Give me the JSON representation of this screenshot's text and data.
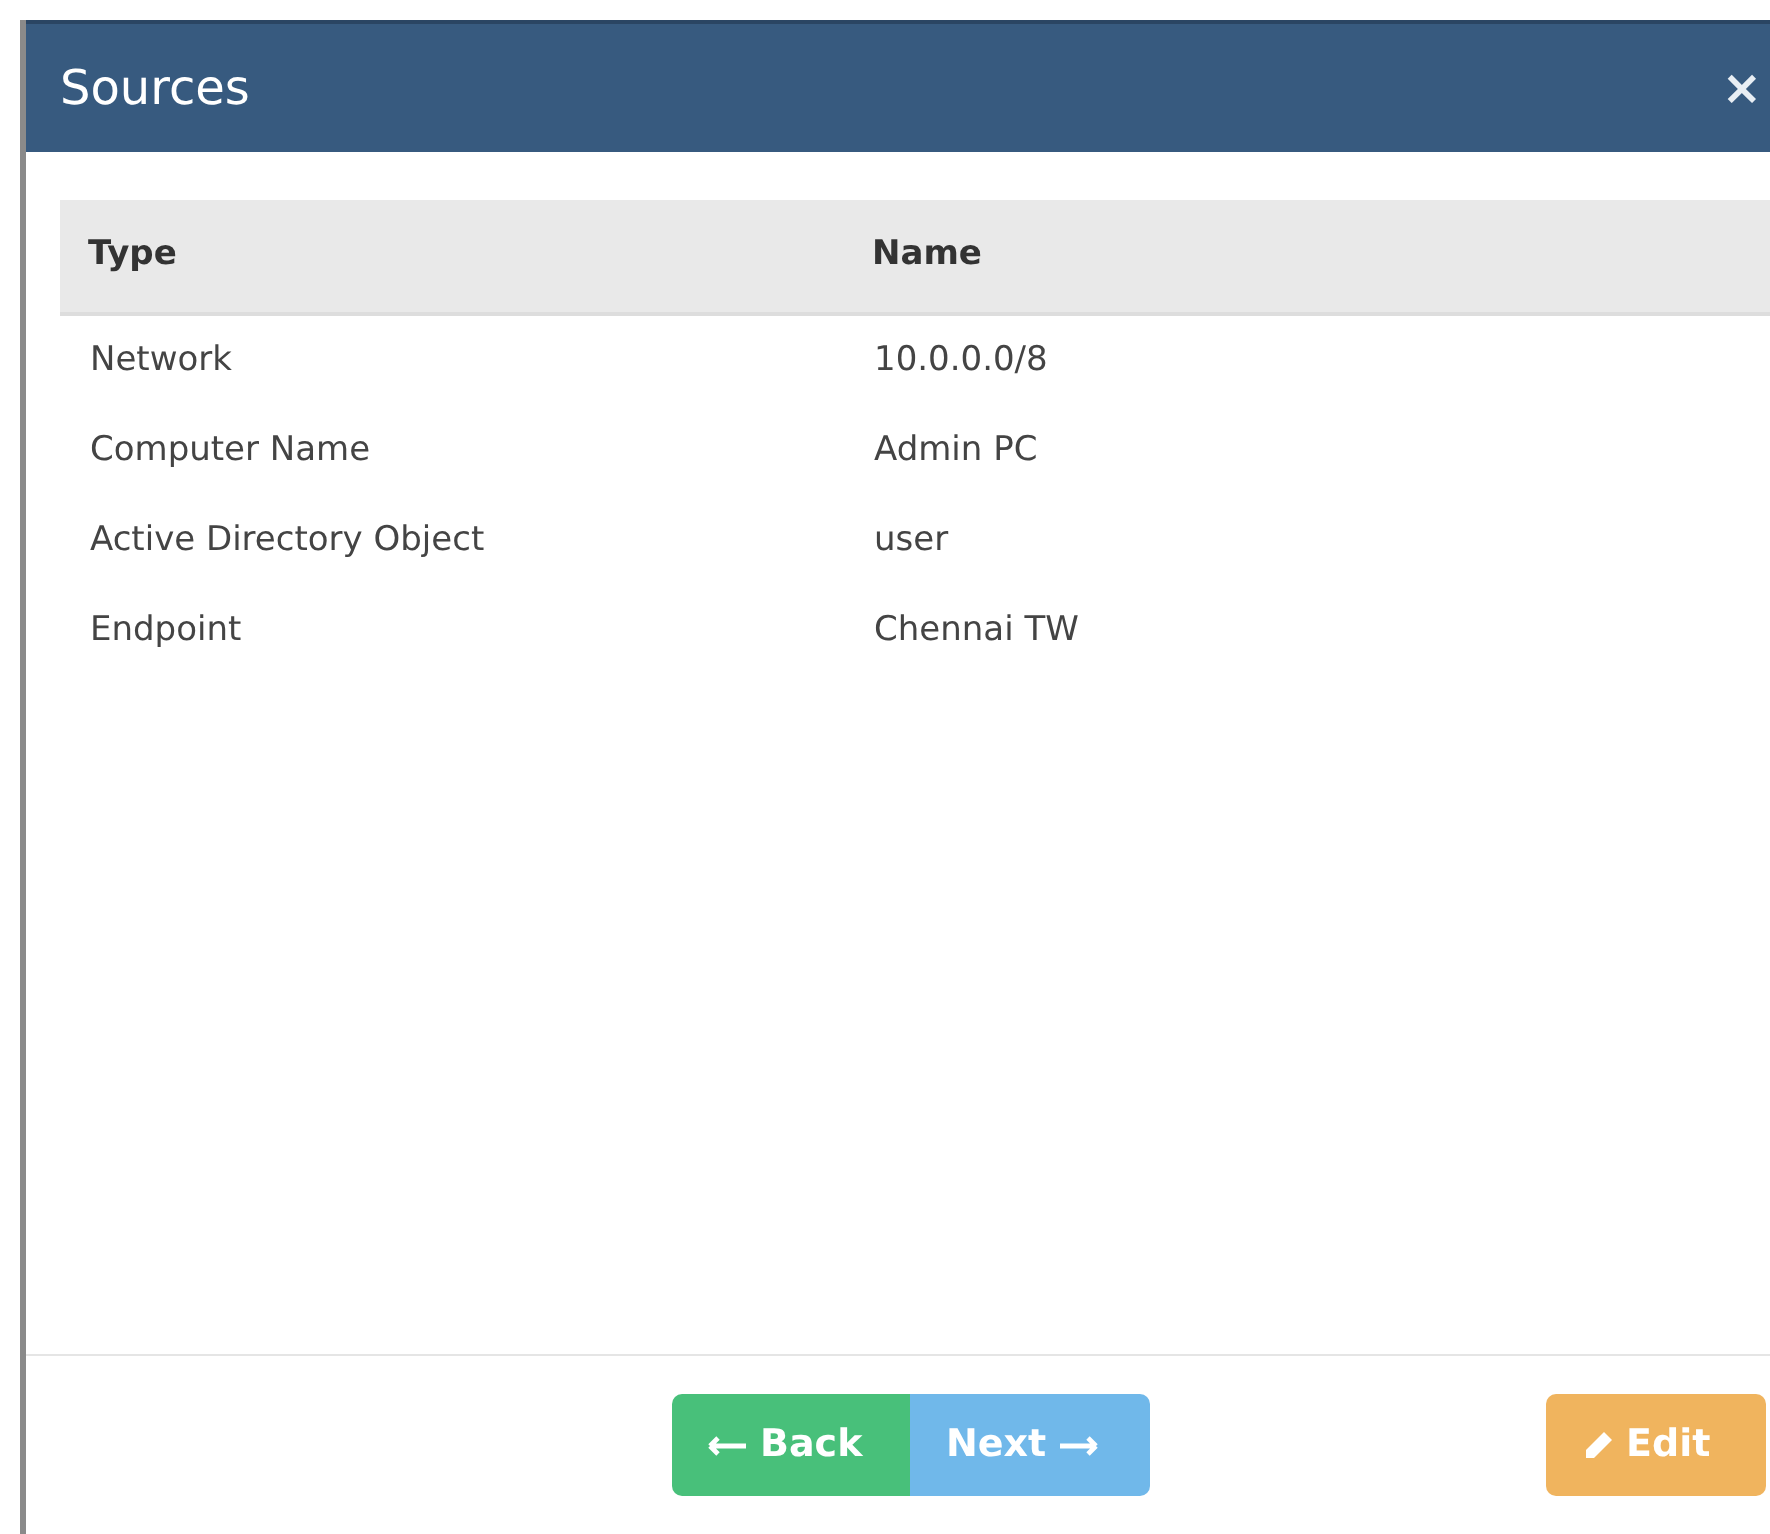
{
  "window": {
    "title": "Sources",
    "close": "×"
  },
  "table": {
    "columns": [
      "Type",
      "Name"
    ],
    "rows": [
      [
        "Network",
        "10.0.0.0/8"
      ],
      [
        "Computer Name",
        "Admin PC"
      ],
      [
        "Active Directory Object",
        "user"
      ],
      [
        "Endpoint",
        "Chennai TW"
      ]
    ]
  },
  "buttons": [
    {
      "kind": "back",
      "label": "Back"
    },
    {
      "kind": "next",
      "label": "Next"
    },
    {
      "kind": "edit",
      "label": "Edit"
    }
  ]
}
